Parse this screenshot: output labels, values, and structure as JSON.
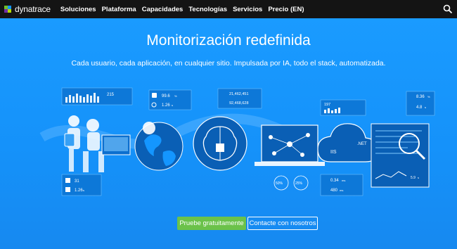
{
  "brand": {
    "name": "dynatrace"
  },
  "nav": {
    "items": [
      {
        "label": "Soluciones"
      },
      {
        "label": "Plataforma"
      },
      {
        "label": "Capacidades"
      },
      {
        "label": "Tecnologías"
      },
      {
        "label": "Servicios"
      },
      {
        "label": "Precio (EN)"
      }
    ]
  },
  "hero": {
    "title": "Monitorización redefinida",
    "subtitle": "Cada usuario, cada aplicación, en cualquier sitio. Impulsada por IA, todo el stack, automatizada.",
    "primary_button": "Pruebe gratuitamente",
    "secondary_button": "Contacte con nosotros"
  },
  "illustration": {
    "metrics": {
      "users_count": "215",
      "services_value": "99.6",
      "services_unit": "%",
      "response_value": "1.26",
      "response_unit": "s",
      "calls_count": "21,462,451",
      "dependencies_count": "92,468,628",
      "apps_count": "197",
      "sessions_count": "31",
      "load_value": "1.26",
      "load_unit": "s",
      "host_cpu": "8.36",
      "host_cpu_unit": "%",
      "host_mem": "4.8",
      "host_mem_unit": "s",
      "process_value": "0.34",
      "process_unit": "ms",
      "db_value": "480",
      "db_unit": "ms",
      "gauge_a": "50%",
      "gauge_b": "25%",
      "chart_value": "5.9",
      "chart_unit": "s"
    },
    "tech_labels": {
      "iis": "IIS",
      "net": ".NET"
    }
  },
  "colors": {
    "hero_bg": "#1496ff",
    "topbar_bg": "#141414",
    "cta_green": "#6bc24a"
  },
  "icons": [
    "dynatrace-logo-icon",
    "search-icon"
  ]
}
